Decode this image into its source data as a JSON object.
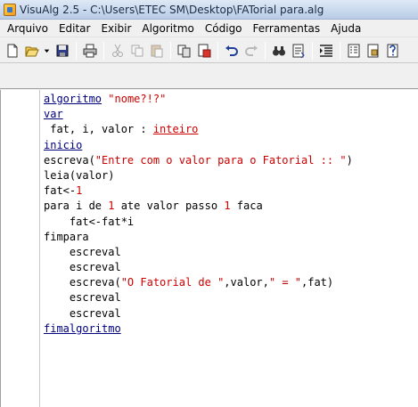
{
  "window": {
    "title": "VisuAlg 2.5 - C:\\Users\\ETEC SM\\Desktop\\FATorial para.alg"
  },
  "menu": {
    "items": [
      "Arquivo",
      "Editar",
      "Exibir",
      "Algoritmo",
      "Código",
      "Ferramentas",
      "Ajuda"
    ]
  },
  "toolbar": {
    "buttons": [
      {
        "name": "new-file-icon"
      },
      {
        "name": "open-folder-icon"
      },
      {
        "name": "dropdown-arrow-icon"
      },
      {
        "name": "save-icon"
      },
      {
        "name": "print-icon"
      },
      {
        "name": "cut-icon"
      },
      {
        "name": "copy-icon"
      },
      {
        "name": "paste-icon"
      },
      {
        "name": "copy-to-file-icon"
      },
      {
        "name": "paste-from-file-icon"
      },
      {
        "name": "undo-icon"
      },
      {
        "name": "redo-icon"
      },
      {
        "name": "find-icon"
      },
      {
        "name": "replace-icon"
      },
      {
        "name": "indent-icon"
      },
      {
        "name": "list-icon"
      },
      {
        "name": "document-icon"
      },
      {
        "name": "help-icon"
      }
    ]
  },
  "code": {
    "lines": [
      [
        {
          "t": "algoritmo",
          "c": "kw"
        },
        {
          "t": " ",
          "c": "sym"
        },
        {
          "t": "\"nome?!?\"",
          "c": "str"
        }
      ],
      [
        {
          "t": "var",
          "c": "kw"
        }
      ],
      [
        {
          "t": " fat, i, valor : ",
          "c": "sym"
        },
        {
          "t": "inteiro",
          "c": "ty"
        }
      ],
      [
        {
          "t": "inicio",
          "c": "kw"
        }
      ],
      [
        {
          "t": "escreva(",
          "c": "sym"
        },
        {
          "t": "\"Entre com o valor para o Fatorial :: \"",
          "c": "str"
        },
        {
          "t": ")",
          "c": "sym"
        }
      ],
      [
        {
          "t": "leia(valor)",
          "c": "sym"
        }
      ],
      [
        {
          "t": "fat<-",
          "c": "sym"
        },
        {
          "t": "1",
          "c": "num"
        }
      ],
      [
        {
          "t": "para i de ",
          "c": "sym"
        },
        {
          "t": "1",
          "c": "num"
        },
        {
          "t": " ate valor passo ",
          "c": "sym"
        },
        {
          "t": "1",
          "c": "num"
        },
        {
          "t": " faca",
          "c": "sym"
        }
      ],
      [
        {
          "t": "    fat<-fat*i",
          "c": "sym"
        }
      ],
      [
        {
          "t": "fimpara",
          "c": "sym"
        }
      ],
      [
        {
          "t": "    escreval",
          "c": "sym"
        }
      ],
      [
        {
          "t": "    escreval",
          "c": "sym"
        }
      ],
      [
        {
          "t": "    escreva(",
          "c": "sym"
        },
        {
          "t": "\"O Fatorial de \"",
          "c": "str"
        },
        {
          "t": ",valor,",
          "c": "sym"
        },
        {
          "t": "\" = \"",
          "c": "str"
        },
        {
          "t": ",fat)",
          "c": "sym"
        }
      ],
      [
        {
          "t": "    escreval",
          "c": "sym"
        }
      ],
      [
        {
          "t": "    escreval",
          "c": "sym"
        }
      ],
      [
        {
          "t": "fimalgoritmo",
          "c": "kw"
        }
      ]
    ]
  }
}
